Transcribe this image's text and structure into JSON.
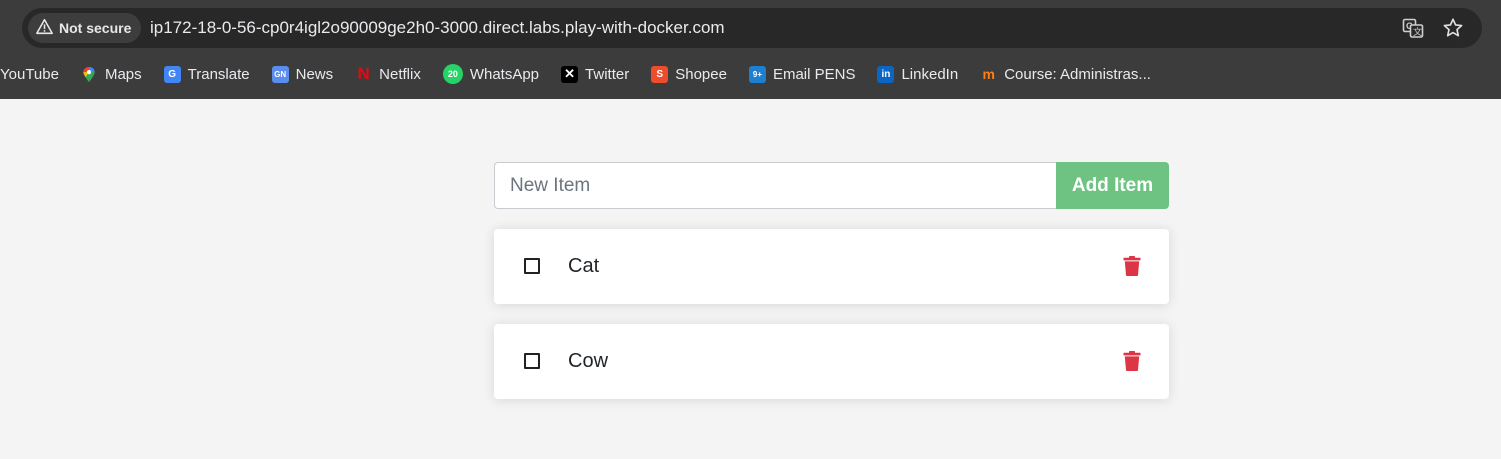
{
  "browser": {
    "security_label": "Not secure",
    "url": "ip172-18-0-56-cp0r4igl2o90009ge2h0-3000.direct.labs.play-with-docker.com",
    "icons": {
      "security": "warning-triangle-icon",
      "translate": "translate-icon",
      "bookmark": "star-icon"
    }
  },
  "bookmarks": [
    {
      "label": "YouTube",
      "icon": "youtube-icon"
    },
    {
      "label": "Maps",
      "icon": "maps-icon"
    },
    {
      "label": "Translate",
      "icon": "translate-icon"
    },
    {
      "label": "News",
      "icon": "news-icon"
    },
    {
      "label": "Netflix",
      "icon": "netflix-icon"
    },
    {
      "label": "WhatsApp",
      "icon": "whatsapp-icon"
    },
    {
      "label": "Twitter",
      "icon": "x-icon"
    },
    {
      "label": "Shopee",
      "icon": "shopee-icon"
    },
    {
      "label": "Email PENS",
      "icon": "zimbra-icon"
    },
    {
      "label": "LinkedIn",
      "icon": "linkedin-icon"
    },
    {
      "label": "Course: Administras...",
      "icon": "moodle-icon"
    }
  ],
  "bookmark_badges": {
    "whatsapp": "20",
    "email": "9+"
  },
  "app": {
    "new_item_placeholder": "New Item",
    "new_item_value": "",
    "add_button_label": "Add Item",
    "accent_color": "#6fc382",
    "delete_color": "#dc3545",
    "items": [
      {
        "name": "Cat",
        "completed": false
      },
      {
        "name": "Cow",
        "completed": false
      }
    ]
  }
}
